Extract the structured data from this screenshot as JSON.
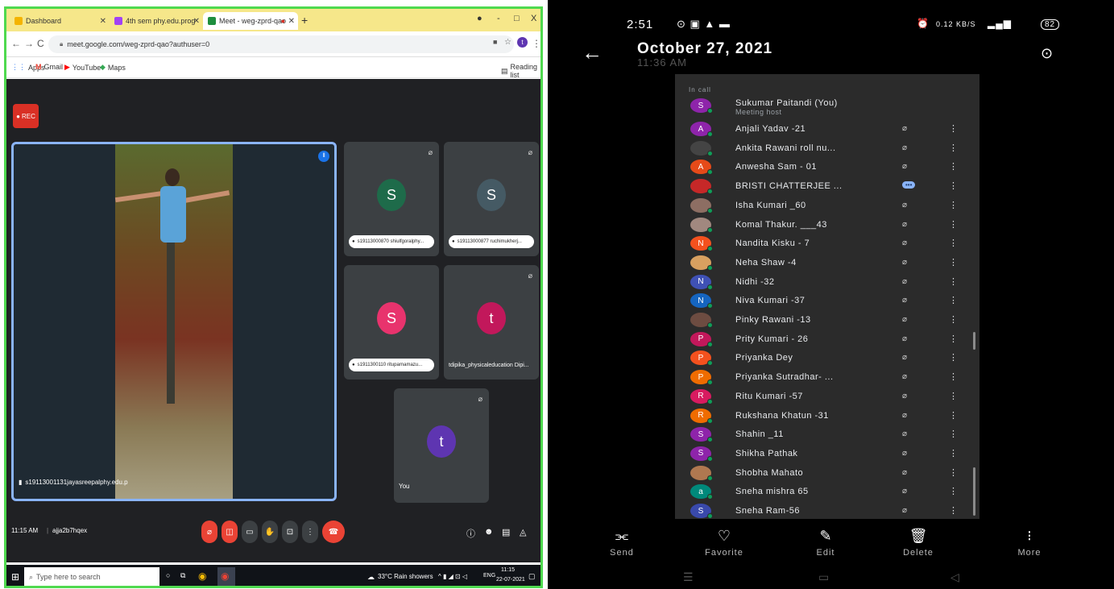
{
  "browser": {
    "tabs": [
      {
        "label": "Dashboard",
        "color": "#f4b400"
      },
      {
        "label": "4th sem phy.edu.prog",
        "color": "#a142f4"
      },
      {
        "label": "Meet - weg-zprd-qao",
        "color": "#1e8e3e"
      }
    ],
    "new_tab": "+",
    "window_controls": [
      "-",
      "□",
      "X"
    ],
    "url": "meet.google.com/weg-zprd-qao?authuser=0",
    "profile_initial": "t",
    "bookmarks": [
      {
        "label": "Apps"
      },
      {
        "label": "Gmail"
      },
      {
        "label": "YouTube"
      },
      {
        "label": "Maps"
      }
    ],
    "reading_list": "Reading list"
  },
  "meet": {
    "rec_label": "REC",
    "main_tile_label": "s19113001131jayasreepalphy.edu.p",
    "tiles": [
      {
        "initial": "S",
        "name": "s19113000870 shiulfgoralphy...",
        "color": "#1e6b4a"
      },
      {
        "initial": "S",
        "name": "s19113000877 ruchimukherj...",
        "color": "#455a64"
      },
      {
        "initial": "S",
        "name": "s1911300110 rituparnamazu...",
        "color": "#e8336d"
      },
      {
        "initial": "t",
        "name": "tdipika_physicaleducation Dipi...",
        "color": "#c2185b"
      },
      {
        "initial": "t",
        "name": "You",
        "color": "#5e35b1"
      }
    ],
    "time_code": "11:15 AM",
    "meeting_code": "ajja2b7hqex"
  },
  "taskbar": {
    "search_placeholder": "Type here to search",
    "weather": "33°C Rain showers",
    "lang": "ENG",
    "clock_time": "11:15",
    "clock_date": "22-07-2021"
  },
  "phone": {
    "status_time": "2:51",
    "status_net": "0.12 KB/S",
    "battery": "82",
    "date": "October 27, 2021",
    "time": "11:36 AM",
    "in_call_label": "In call",
    "host": {
      "initial": "S",
      "name": "Sukumar Paitandi (You)",
      "subtitle": "Meeting host",
      "color": "#8e24aa"
    },
    "participants": [
      {
        "initial": "A",
        "name": "Anjali Yadav -21",
        "color": "#8e24aa"
      },
      {
        "initial": "",
        "name": "Ankita Rawani roll nu...",
        "color": "#444444"
      },
      {
        "initial": "A",
        "name": "Anwesha Sam - 01",
        "color": "#e64a19"
      },
      {
        "initial": "",
        "name": "BRISTI CHATTERJEE ...",
        "color": "#c62828",
        "speaking": true
      },
      {
        "initial": "",
        "name": "Isha Kumari _60",
        "color": "#8d6e63"
      },
      {
        "initial": "",
        "name": "Komal Thakur. ___43",
        "color": "#a1887f"
      },
      {
        "initial": "N",
        "name": "Nandita Kisku - 7",
        "color": "#f4511e"
      },
      {
        "initial": "",
        "name": "Neha Shaw -4",
        "color": "#d8a060"
      },
      {
        "initial": "N",
        "name": "Nidhi -32",
        "color": "#3f51b5"
      },
      {
        "initial": "N",
        "name": "Niva Kumari -37",
        "color": "#1565c0"
      },
      {
        "initial": "",
        "name": "Pinky Rawani -13",
        "color": "#6d4c41"
      },
      {
        "initial": "P",
        "name": "Prity Kumari - 26",
        "color": "#c2185b"
      },
      {
        "initial": "P",
        "name": "Priyanka Dey",
        "color": "#f4511e"
      },
      {
        "initial": "P",
        "name": "Priyanka Sutradhar- ...",
        "color": "#ef6c00"
      },
      {
        "initial": "R",
        "name": "Ritu Kumari -57",
        "color": "#d81b60"
      },
      {
        "initial": "R",
        "name": "Rukshana Khatun -31",
        "color": "#ef6c00"
      },
      {
        "initial": "S",
        "name": "Shahin _11",
        "color": "#8e24aa"
      },
      {
        "initial": "S",
        "name": "Shikha Pathak",
        "color": "#8e24aa"
      },
      {
        "initial": "",
        "name": "Shobha Mahato",
        "color": "#b07850"
      },
      {
        "initial": "a",
        "name": "Sneha mishra 65",
        "color": "#00897b"
      },
      {
        "initial": "S",
        "name": "Sneha Ram-56",
        "color": "#3949ab"
      }
    ],
    "actions": [
      {
        "label": "Send",
        "icon": "share-icon"
      },
      {
        "label": "Favorite",
        "icon": "heart-icon"
      },
      {
        "label": "Edit",
        "icon": "edit-icon"
      },
      {
        "label": "Delete",
        "icon": "trash-icon"
      },
      {
        "label": "More",
        "icon": "more-icon"
      }
    ]
  }
}
